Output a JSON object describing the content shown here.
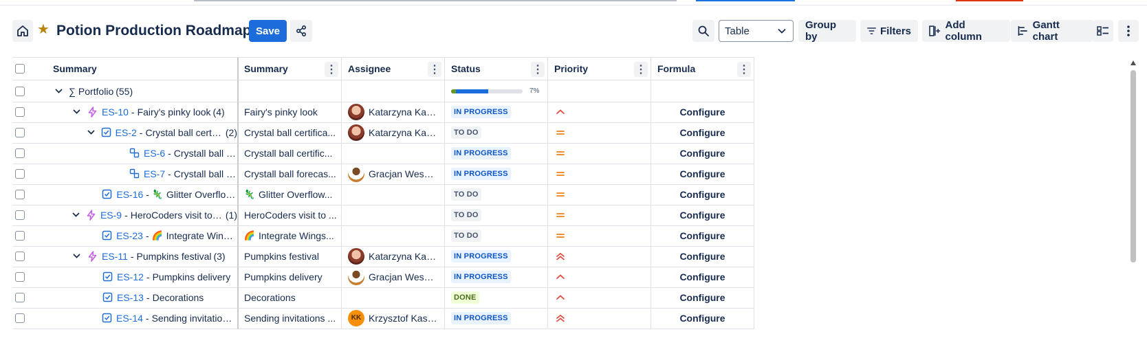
{
  "header": {
    "title": "Potion Production Roadmap",
    "save_label": "Save",
    "view_select": "Table",
    "group_by_label": "Group by",
    "filters_label": "Filters",
    "add_column_label": "Add column",
    "gantt_label": "Gantt chart"
  },
  "columns": [
    "Summary",
    "Summary",
    "Assignee",
    "Status",
    "Priority",
    "Formula"
  ],
  "portfolio": {
    "prefix": "∑ Portfolio",
    "count": "(55)",
    "progress_label": "7%",
    "progress_inprogress": 0.52,
    "progress_done": 0.07
  },
  "rows": [
    {
      "key": "ES-10",
      "title": "Fairy's pinky look",
      "count": "(4)",
      "summary": "Fairy's pinky look",
      "assignee": "Katarzyna Kars...",
      "avatar": "kat",
      "status": "IN PROGRESS",
      "status_kind": "inprogress",
      "priority": "high",
      "formula": "Configure",
      "indent": 1,
      "type": "epic",
      "chevron": "down"
    },
    {
      "key": "ES-2",
      "title": "Crystal ball certific...",
      "count": "(2)",
      "summary": "Crystal ball certifica...",
      "assignee": "Katarzyna Kars...",
      "avatar": "kat",
      "status": "TO DO",
      "status_kind": "todo",
      "priority": "medium",
      "formula": "Configure",
      "indent": 2,
      "type": "task",
      "chevron": "down"
    },
    {
      "key": "ES-6",
      "title": "Crystall ball certif...",
      "count": "",
      "summary": "Crystall ball certific...",
      "assignee": "",
      "avatar": "",
      "status": "IN PROGRESS",
      "status_kind": "inprogress",
      "priority": "medium",
      "formula": "Configure",
      "indent": 3,
      "type": "subtask",
      "chevron": ""
    },
    {
      "key": "ES-7",
      "title": "Crystall ball forec...",
      "count": "",
      "summary": "Crystall ball forecas...",
      "assignee": "Gracjan Wesoł...",
      "avatar": "grac",
      "status": "IN PROGRESS",
      "status_kind": "inprogress",
      "priority": "medium",
      "formula": "Configure",
      "indent": 3,
      "type": "subtask",
      "chevron": ""
    },
    {
      "key": "ES-16",
      "title": "Glitter Overflow...",
      "emoji": "🦎",
      "count": "",
      "summary": "Glitter Overflow...",
      "assignee": "",
      "avatar": "",
      "status": "TO DO",
      "status_kind": "todo",
      "priority": "medium",
      "formula": "Configure",
      "indent": 2,
      "type": "task",
      "chevron": ""
    },
    {
      "key": "ES-9",
      "title": "HeroCoders visit to th...",
      "count": "(1)",
      "summary": "HeroCoders visit to ...",
      "assignee": "",
      "avatar": "",
      "status": "TO DO",
      "status_kind": "todo",
      "priority": "medium",
      "formula": "Configure",
      "indent": 1,
      "type": "epic",
      "chevron": "down"
    },
    {
      "key": "ES-23",
      "title": "Integrate Wings...",
      "emoji": "🌈",
      "count": "",
      "summary": "Integrate Wings...",
      "assignee": "",
      "avatar": "",
      "status": "TO DO",
      "status_kind": "todo",
      "priority": "medium",
      "formula": "Configure",
      "indent": 2,
      "type": "task",
      "chevron": ""
    },
    {
      "key": "ES-11",
      "title": "Pumpkins festival",
      "count": "(3)",
      "summary": "Pumpkins festival",
      "assignee": "Katarzyna Kars...",
      "avatar": "kat",
      "status": "IN PROGRESS",
      "status_kind": "inprogress",
      "priority": "highest",
      "formula": "Configure",
      "indent": 1,
      "type": "epic",
      "chevron": "down"
    },
    {
      "key": "ES-12",
      "title": "Pumpkins delivery",
      "count": "",
      "summary": "Pumpkins delivery",
      "assignee": "Gracjan Wesoł...",
      "avatar": "grac",
      "status": "IN PROGRESS",
      "status_kind": "inprogress",
      "priority": "high",
      "formula": "Configure",
      "indent": 2,
      "type": "task",
      "chevron": ""
    },
    {
      "key": "ES-13",
      "title": "Decorations",
      "count": "",
      "summary": "Decorations",
      "assignee": "",
      "avatar": "",
      "status": "DONE",
      "status_kind": "done",
      "priority": "high",
      "formula": "Configure",
      "indent": 2,
      "type": "task",
      "chevron": ""
    },
    {
      "key": "ES-14",
      "title": "Sending invitations ...",
      "count": "",
      "summary": "Sending invitations ...",
      "assignee": "Krzysztof Kasp...",
      "avatar": "kk",
      "avatar_initials": "KK",
      "status": "IN PROGRESS",
      "status_kind": "inprogress",
      "priority": "highest",
      "formula": "Configure",
      "indent": 2,
      "type": "task",
      "chevron": ""
    }
  ],
  "colors": {
    "accent": "#1c6ddb",
    "star": "#b8860b",
    "priority": "#e2483d",
    "epic": "#c45de5",
    "link": "#1c6ddb"
  }
}
